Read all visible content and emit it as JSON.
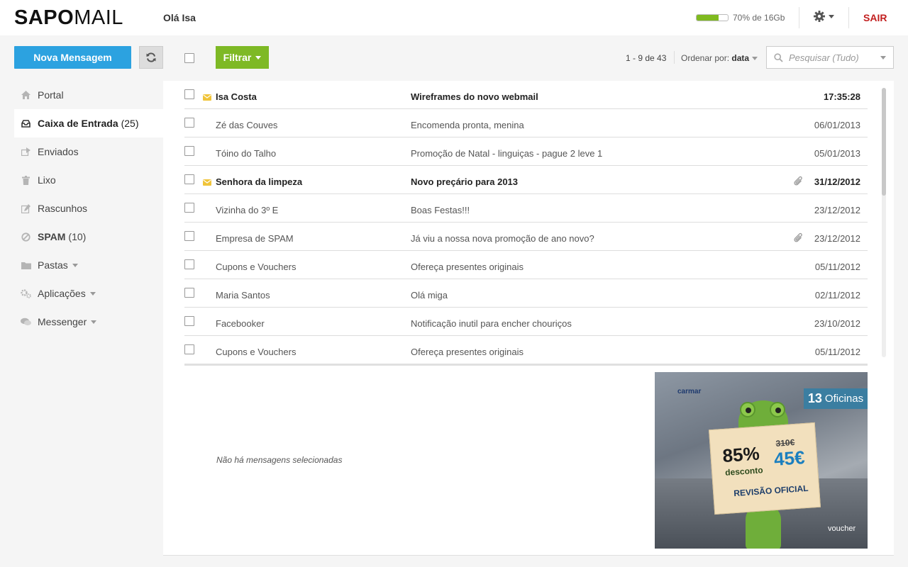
{
  "header": {
    "logo_bold": "SAPO",
    "logo_light": "MAIL",
    "greeting": "Olá Isa",
    "quota_text": "70% de 16Gb",
    "quota_percent": 70,
    "logout": "SAIR"
  },
  "toolbar": {
    "new_message": "Nova Mensagem",
    "filter": "Filtrar",
    "pagination": "1 - 9 de 43",
    "sort_label": "Ordenar por:",
    "sort_value": "data",
    "search_placeholder": "Pesquisar (Tudo)"
  },
  "sidebar": {
    "items": [
      {
        "label": "Portal",
        "icon": "home-icon"
      },
      {
        "label": "Caixa de Entrada",
        "count": "(25)",
        "icon": "inbox-icon",
        "active": true
      },
      {
        "label": "Enviados",
        "icon": "sent-icon"
      },
      {
        "label": "Lixo",
        "icon": "trash-icon"
      },
      {
        "label": "Rascunhos",
        "icon": "draft-icon"
      },
      {
        "label": "SPAM",
        "count": "(10)",
        "icon": "spam-icon"
      },
      {
        "label": "Pastas",
        "icon": "folder-icon",
        "dropdown": true
      },
      {
        "label": "Aplicações",
        "icon": "apps-icon",
        "dropdown": true
      },
      {
        "label": "Messenger",
        "icon": "chat-icon",
        "dropdown": true
      }
    ]
  },
  "messages": [
    {
      "from": "Isa Costa",
      "subject": "Wireframes do novo webmail",
      "date": "17:35:28",
      "unread": true,
      "attachment": false
    },
    {
      "from": "Zé das Couves",
      "subject": "Encomenda pronta, menina",
      "date": "06/01/2013",
      "unread": false,
      "attachment": false
    },
    {
      "from": "Tóino do Talho",
      "subject": "Promoção de Natal - linguiças - pague 2 leve 1",
      "date": "05/01/2013",
      "unread": false,
      "attachment": false
    },
    {
      "from": "Senhora da limpeza",
      "subject": "Novo preçário para 2013",
      "date": "31/12/2012",
      "unread": true,
      "attachment": true
    },
    {
      "from": "Vizinha do 3º E",
      "subject": "Boas Festas!!!",
      "date": "23/12/2012",
      "unread": false,
      "attachment": false
    },
    {
      "from": "Empresa de SPAM",
      "subject": "Já viu a nossa nova promoção de ano novo?",
      "date": "23/12/2012",
      "unread": false,
      "attachment": true
    },
    {
      "from": "Cupons e Vouchers",
      "subject": "Ofereça presentes originais",
      "date": "05/11/2012",
      "unread": false,
      "attachment": false
    },
    {
      "from": "Maria Santos",
      "subject": "Olá miga",
      "date": "02/11/2012",
      "unread": false,
      "attachment": false
    },
    {
      "from": "Facebooker",
      "subject": "Notificação inutil para encher chouriços",
      "date": "23/10/2012",
      "unread": false,
      "attachment": false
    },
    {
      "from": "Cupons e Vouchers",
      "subject": "Ofereça presentes originais",
      "date": "05/11/2012",
      "unread": false,
      "attachment": false
    }
  ],
  "preview": {
    "empty_text": "Não há mensagens selecionadas"
  },
  "ad": {
    "brand": "carmar",
    "badge_number": "13",
    "badge_text": "Oficinas",
    "discount": "85%",
    "discount_label": "desconto",
    "old_price": "310€",
    "new_price": "45€",
    "service": "REVISÃO OFICIAL",
    "voucher": "voucher"
  },
  "colors": {
    "primary_button": "#2ca2e0",
    "filter_button": "#7eb925",
    "logout": "#c21f1f",
    "quota_fill": "#7fba1f"
  }
}
